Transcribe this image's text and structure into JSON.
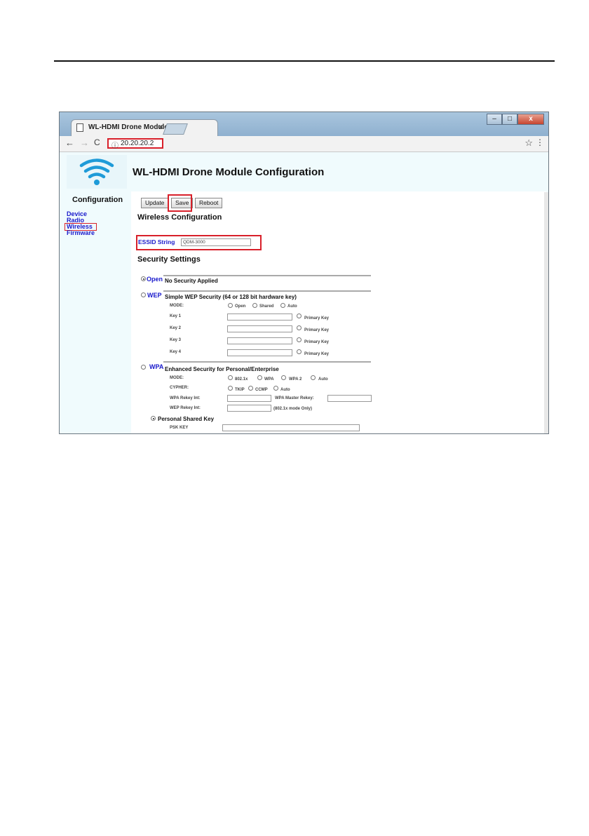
{
  "browser": {
    "tab_title": "WL-HDMI Drone Module",
    "tab_close": "×",
    "url": "20.20.20.2",
    "win_minimize": "–",
    "win_maximize": "□",
    "win_close": "x",
    "back": "←",
    "forward": "→",
    "reload": "C",
    "info": "ⓘ",
    "star": "☆",
    "menu": "⋮"
  },
  "header": {
    "title": "WL-HDMI Drone Module Configuration"
  },
  "sidebar": {
    "title": "Configuration",
    "links": [
      "Device",
      "Radio",
      "Wireless",
      "Firmware"
    ]
  },
  "toolbar": {
    "update": "Update",
    "save": "Save",
    "reboot": "Reboot"
  },
  "wireless": {
    "heading": "Wireless Configuration",
    "essid_label": "ESSID String",
    "essid_value": "QDM-3000"
  },
  "security": {
    "heading": "Security Settings",
    "open": {
      "label": "Open",
      "desc": "No Security Applied"
    },
    "wep": {
      "label": "WEP",
      "desc": "Simple WEP Security (64 or 128 bit hardware key)",
      "mode_label": "MODE:",
      "modes": [
        "Open",
        "Shared",
        "Auto"
      ],
      "keys": [
        "Key 1",
        "Key 2",
        "Key 3",
        "Key 4"
      ],
      "primary_key": "Primary Key"
    },
    "wpa": {
      "label": "WPA",
      "desc": "Enhanced Security for Personal/Enterprise",
      "mode_label": "MODE:",
      "modes": [
        "802.1x",
        "WPA",
        "WPA 2",
        "Auto"
      ],
      "cypher_label": "CYPHER:",
      "cyphers": [
        "TKIP",
        "CCMP",
        "Auto"
      ],
      "rekey_label": "WPA Rekey Int:",
      "master_rekey_label": "WPA Master Rekey:",
      "wep_rekey_label": "WEP Rekey Int:",
      "wep_rekey_note": "(802.1x mode Only)",
      "psk_option": "Personal Shared Key",
      "psk_label": "PSK KEY"
    }
  }
}
